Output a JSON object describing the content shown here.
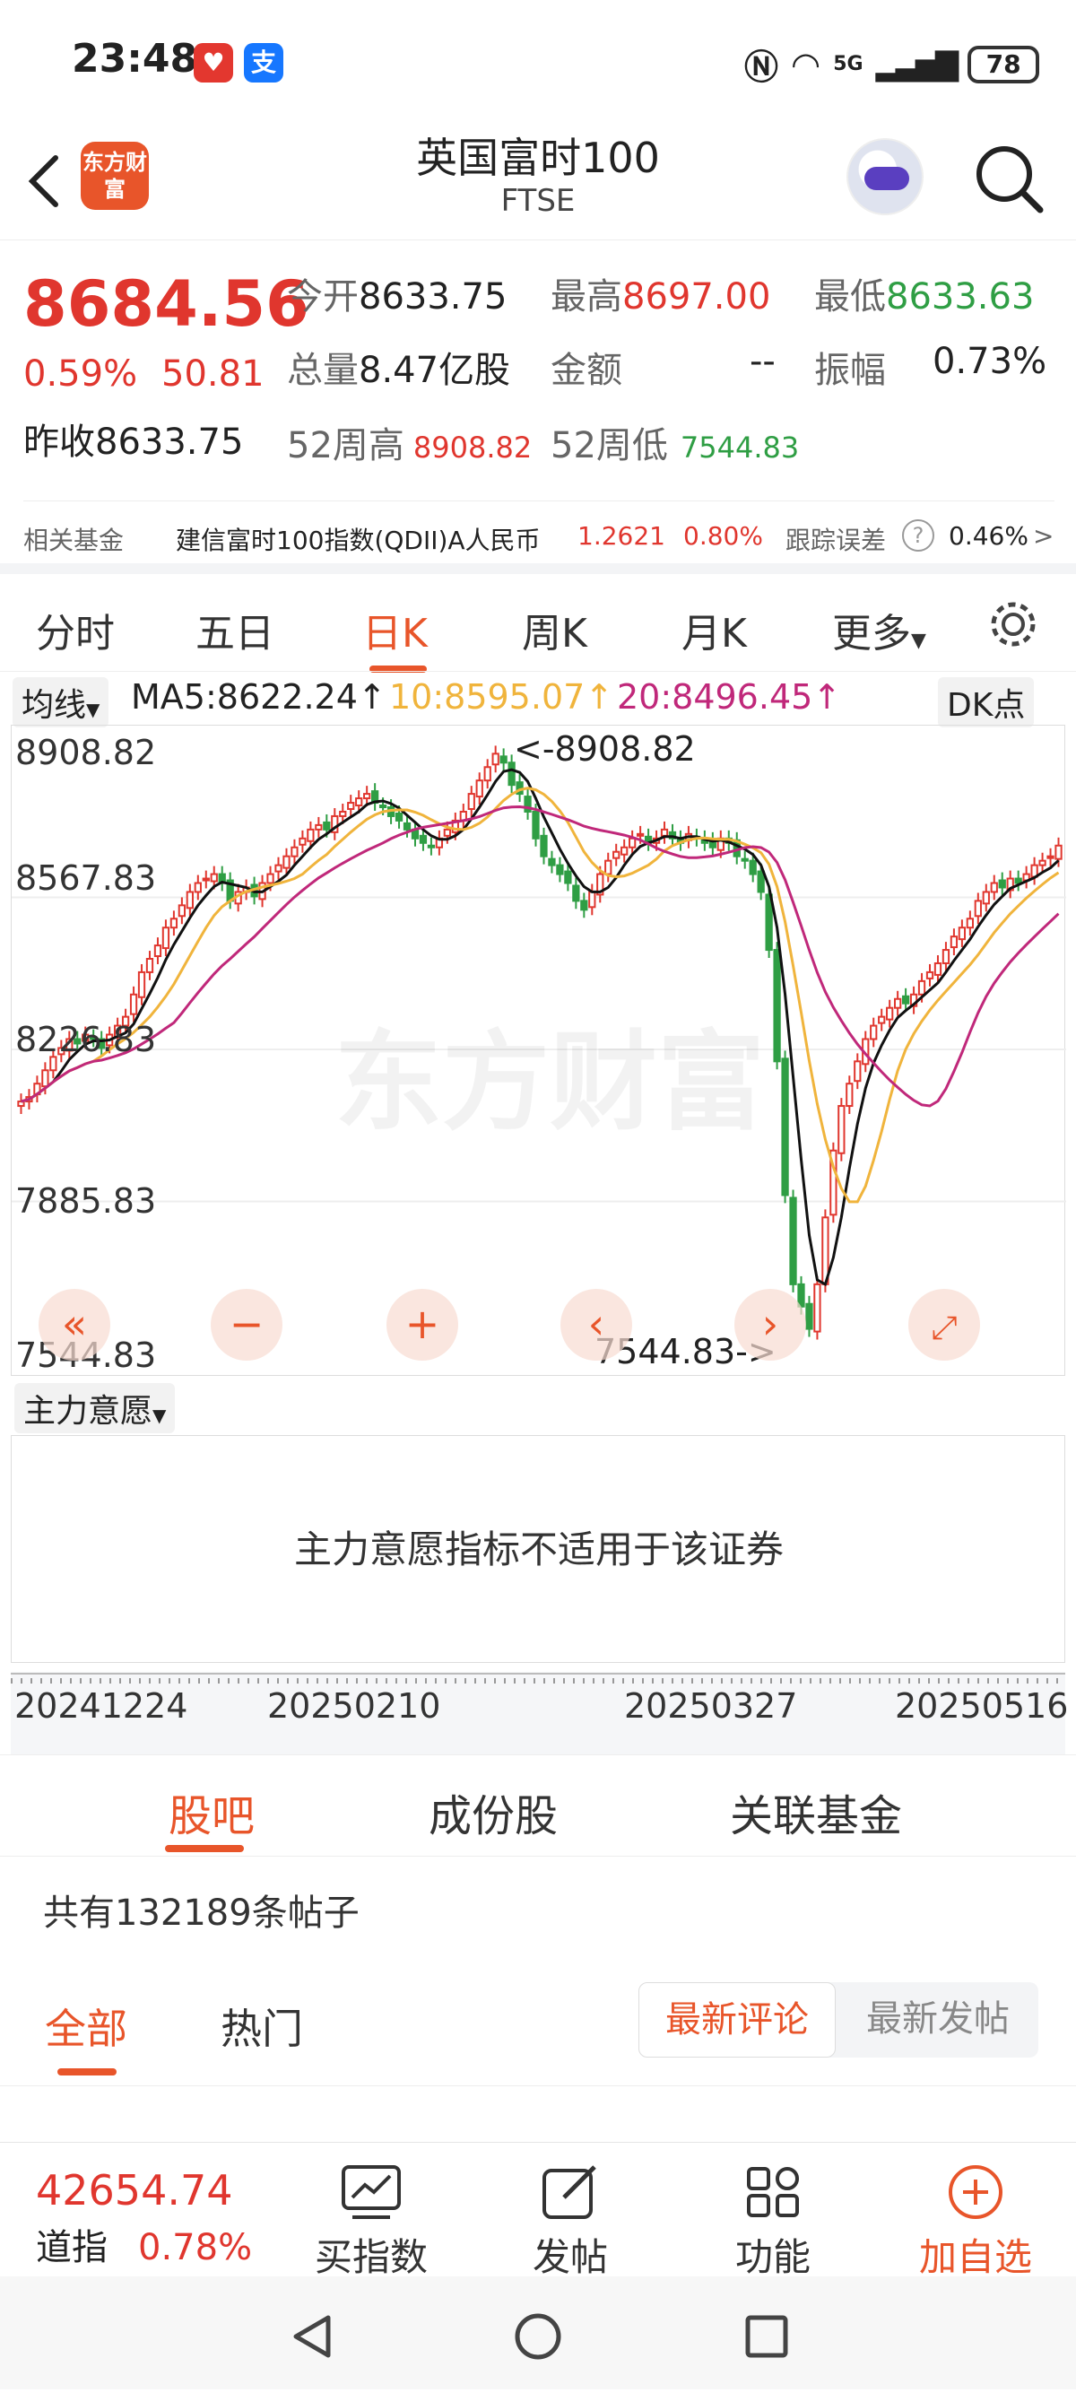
{
  "status_bar": {
    "time": "23:48",
    "battery": "78",
    "network": "5G"
  },
  "header": {
    "title": "英国富时100",
    "subtitle": "FTSE",
    "logo_text": "东方财富"
  },
  "quote": {
    "price": "8684.56",
    "change_pct": "0.59%",
    "change": "50.81",
    "open_label": "今开",
    "open": "8633.75",
    "high_label": "最高",
    "high": "8697.00",
    "low_label": "最低",
    "low": "8633.63",
    "volume_label": "总量",
    "volume": "8.47亿股",
    "amount_label": "金额",
    "amount": "--",
    "amplitude_label": "振幅",
    "amplitude": "0.73%",
    "prev_close_label": "昨收",
    "prev_close": "8633.75",
    "wk52_high_label": "52周高",
    "wk52_high": "8908.82",
    "wk52_low_label": "52周低",
    "wk52_low": "7544.83"
  },
  "fund_row": {
    "label": "相关基金",
    "fund_name": "建信富时100指数(QDII)A人民币",
    "nav": "1.2621",
    "nav_change": "0.80%",
    "tracking_label": "跟踪误差",
    "tracking": "0.46%",
    "arrow": ">"
  },
  "chart_tabs": [
    {
      "label": "分时"
    },
    {
      "label": "五日"
    },
    {
      "label": "日K"
    },
    {
      "label": "周K"
    },
    {
      "label": "月K"
    },
    {
      "label": "更多"
    }
  ],
  "active_tab": "日K",
  "ma_row": {
    "selector": "均线",
    "ma5": "MA5:8622.24↑",
    "ma10": "10:8595.07↑",
    "ma20": "20:8496.45↑",
    "dk": "DK点"
  },
  "chart_data": {
    "type": "candlestick",
    "y_ticks": [
      "8908.82",
      "8567.83",
      "8226.83",
      "7885.83",
      "7544.83"
    ],
    "ylim": [
      7544.83,
      8908.82
    ],
    "max_annotation": "<-8908.82",
    "min_annotation": "7544.83->",
    "x_ticks": [
      "20241224",
      "20250210",
      "20250327",
      "20250516"
    ],
    "colors": {
      "up": "#e0362e",
      "down": "#2f9e44",
      "ma5": "#111111",
      "ma10": "#f0b43c",
      "ma20": "#c0287a"
    },
    "closes": [
      8110,
      8120,
      8150,
      8180,
      8210,
      8230,
      8250,
      8240,
      8260,
      8250,
      8230,
      8260,
      8280,
      8300,
      8350,
      8400,
      8430,
      8460,
      8500,
      8520,
      8550,
      8580,
      8600,
      8610,
      8620,
      8600,
      8560,
      8580,
      8590,
      8570,
      8600,
      8620,
      8640,
      8660,
      8680,
      8700,
      8720,
      8730,
      8720,
      8750,
      8760,
      8780,
      8790,
      8800,
      8780,
      8770,
      8750,
      8740,
      8720,
      8700,
      8690,
      8680,
      8700,
      8720,
      8740,
      8760,
      8800,
      8830,
      8860,
      8890,
      8870,
      8820,
      8800,
      8760,
      8700,
      8660,
      8640,
      8620,
      8600,
      8560,
      8540,
      8580,
      8620,
      8650,
      8670,
      8680,
      8700,
      8710,
      8690,
      8700,
      8720,
      8700,
      8690,
      8710,
      8700,
      8690,
      8680,
      8700,
      8690,
      8660,
      8650,
      8620,
      8580,
      8450,
      8200,
      7900,
      7700,
      7650,
      7600,
      7700,
      7850,
      8000,
      8100,
      8150,
      8200,
      8250,
      8280,
      8300,
      8320,
      8340,
      8330,
      8350,
      8380,
      8400,
      8420,
      8450,
      8480,
      8500,
      8520,
      8560,
      8580,
      8600,
      8590,
      8610,
      8600,
      8620,
      8640,
      8650,
      8660,
      8684
    ]
  },
  "indicator": {
    "selector": "主力意愿",
    "message": "主力意愿指标不适用于该证券"
  },
  "community_tabs": [
    {
      "label": "股吧"
    },
    {
      "label": "成份股"
    },
    {
      "label": "关联基金"
    }
  ],
  "post_count": "共有132189条帖子",
  "filter": {
    "all": "全部",
    "hot": "热门",
    "sort_latest_comment": "最新评论",
    "sort_latest_post": "最新发帖"
  },
  "bottom_bar": {
    "index_value": "42654.74",
    "index_name": "道指",
    "index_change": "0.78%",
    "buttons": [
      {
        "label": "买指数"
      },
      {
        "label": "发帖"
      },
      {
        "label": "功能"
      },
      {
        "label": "加自选"
      }
    ]
  }
}
